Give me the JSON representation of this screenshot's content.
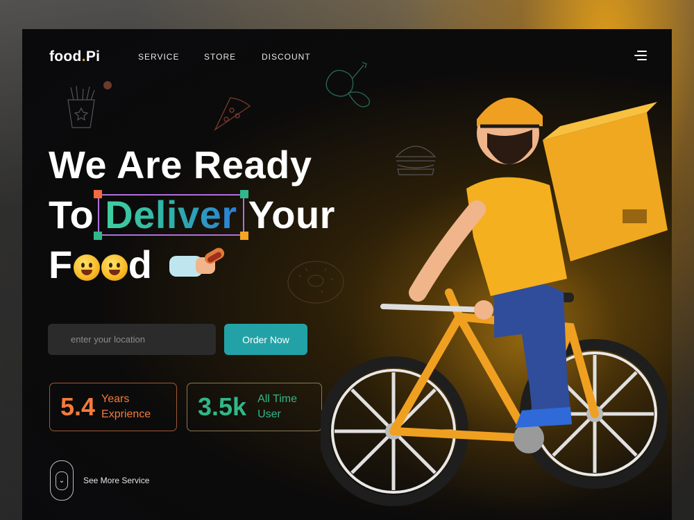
{
  "brand": {
    "name": "food",
    "dot": ".",
    "suffix": "Pi"
  },
  "nav": {
    "items": [
      "SERVICE",
      "STORE",
      "DISCOUNT"
    ]
  },
  "hero": {
    "line1": "We Are Ready",
    "line2_start": "To",
    "line2_highlight": "Deliver",
    "line2_end": "Your",
    "line3_start": "F",
    "line3_end": "d"
  },
  "search": {
    "placeholder": "enter your location",
    "value": ""
  },
  "cta": {
    "label": "Order Now"
  },
  "stats": [
    {
      "value": "5.4",
      "label_line1": "Years",
      "label_line2": "Exprience",
      "color": "#f47b3c"
    },
    {
      "value": "3.5k",
      "label_line1": "All Time",
      "label_line2": "User",
      "color": "#2fb88a"
    }
  ],
  "see_more": {
    "label": "See More Service"
  },
  "colors": {
    "accent": "#f5a524",
    "teal": "#22a2a6",
    "deliver_box": "#b070e0"
  }
}
